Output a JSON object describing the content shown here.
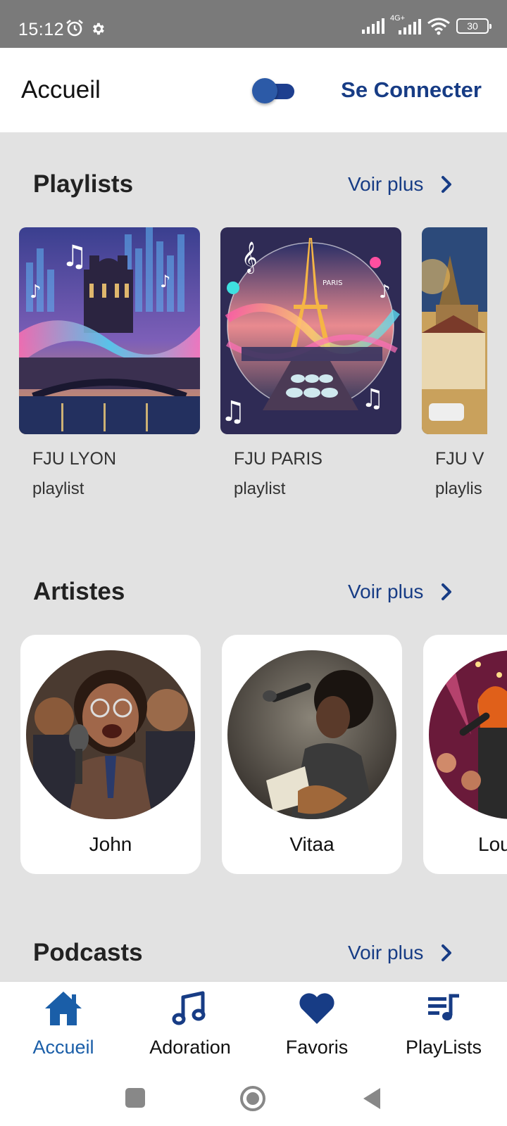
{
  "status_bar": {
    "time": "15:12",
    "network": "4G+",
    "battery": "30",
    "icons": [
      "alarm-icon",
      "gear-icon",
      "signal-icon",
      "wifi-icon",
      "battery-icon"
    ]
  },
  "app_bar": {
    "title": "Accueil",
    "connect_label": "Se Connecter",
    "theme_toggle_on": true
  },
  "sections": {
    "playlists": {
      "title": "Playlists",
      "more_label": "Voir plus",
      "items": [
        {
          "name": "FJU LYON",
          "type": "playlist"
        },
        {
          "name": "FJU PARIS",
          "type": "playlist"
        },
        {
          "name": "FJU V",
          "type": "playlis"
        }
      ]
    },
    "artists": {
      "title": "Artistes",
      "more_label": "Voir plus",
      "items": [
        {
          "name": "John"
        },
        {
          "name": "Vitaa"
        },
        {
          "name": "Lou"
        }
      ]
    },
    "podcasts": {
      "title": "Podcasts",
      "more_label": "Voir plus"
    }
  },
  "bottom_nav": {
    "items": [
      {
        "label": "Accueil",
        "icon": "home-icon",
        "active": true
      },
      {
        "label": "Adoration",
        "icon": "music-note-icon",
        "active": false
      },
      {
        "label": "Favoris",
        "icon": "heart-icon",
        "active": false
      },
      {
        "label": "PlayLists",
        "icon": "playlist-icon",
        "active": false
      }
    ]
  },
  "colors": {
    "accent": "#173c85",
    "active_nav": "#1a5ea8",
    "background": "#e2e2e2"
  }
}
